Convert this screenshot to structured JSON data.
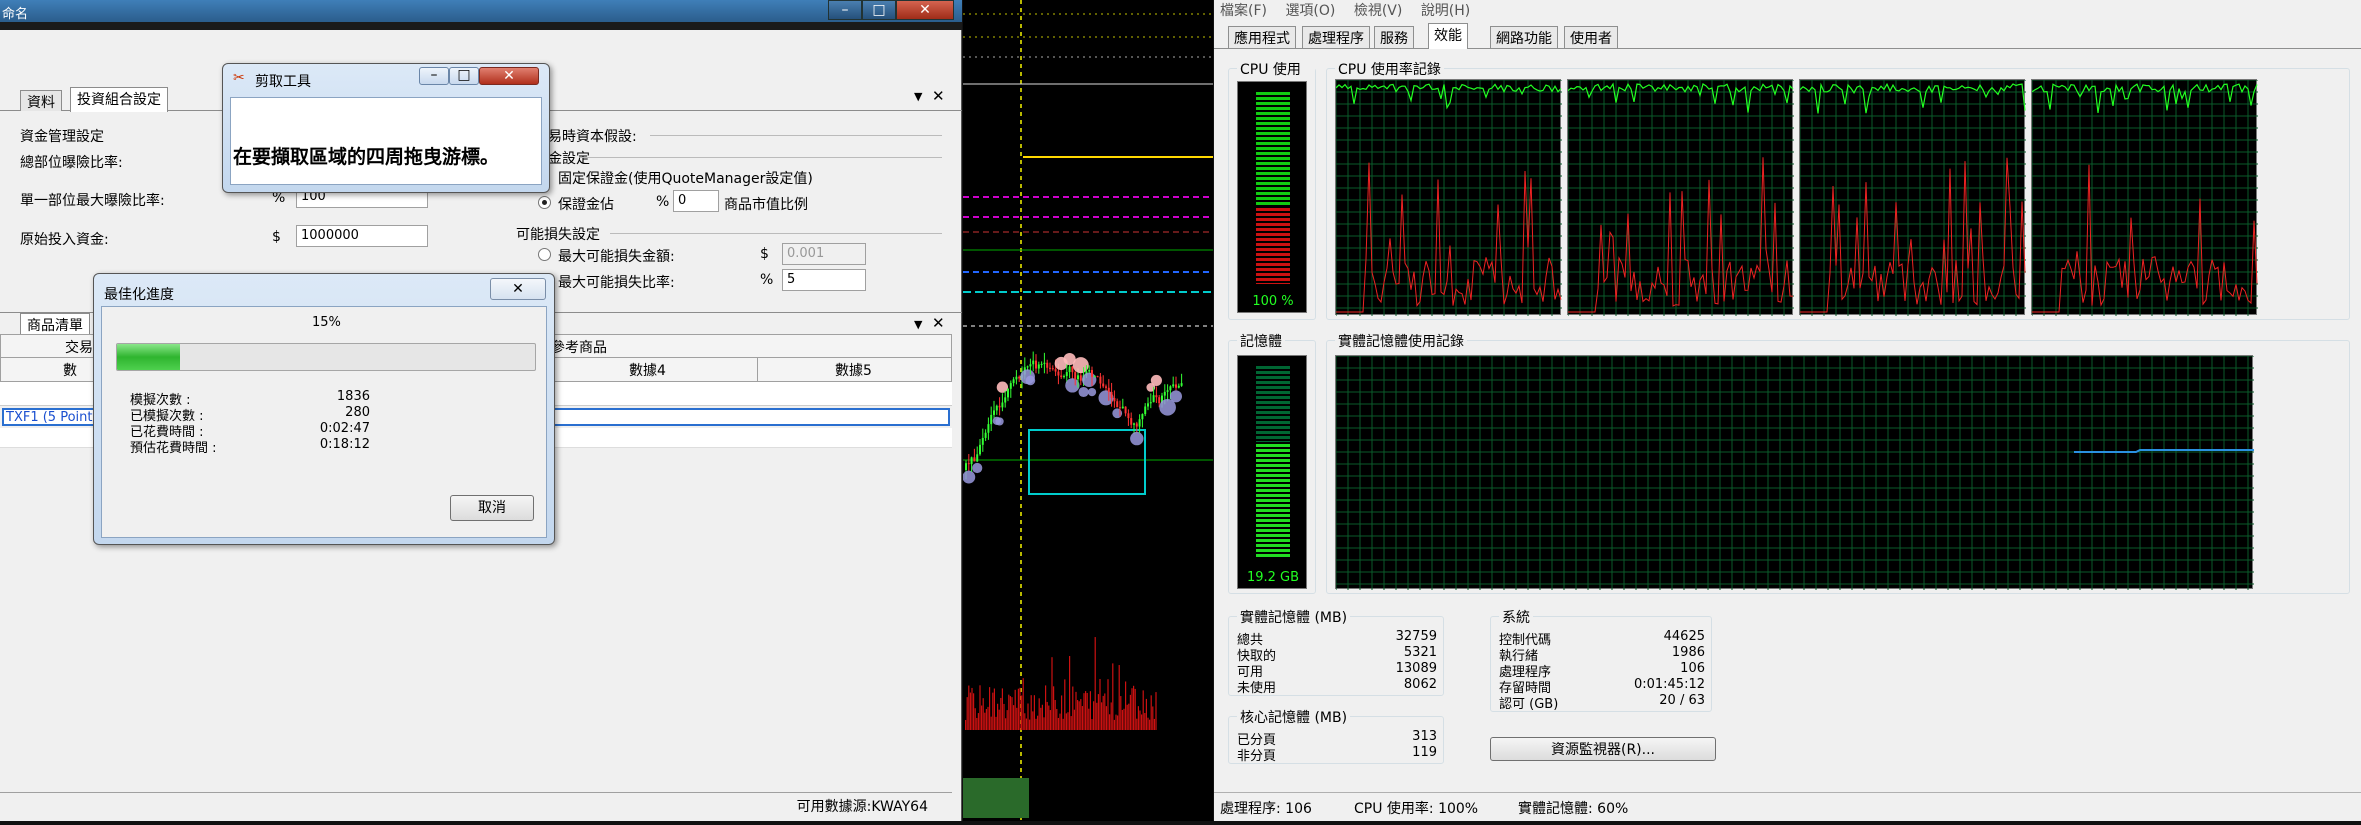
{
  "left_window": {
    "title": "命名",
    "tabs": [
      "資料",
      "投資組合設定"
    ],
    "settings": {
      "money_mgmt": "資金管理設定",
      "total_risk": "總部位曝險比率:",
      "single_risk": "單一部位最大曝險比率:",
      "single_risk_unit": "%",
      "single_risk_value": "100",
      "initial_capital": "原始投入資金:",
      "initial_capital_unit": "$",
      "initial_capital_value": "1000000",
      "trade_capital": "易時資本假設:",
      "margin_settings": "金設定",
      "fixed_margin": "固定保證金(使用QuoteManager設定值)",
      "margin_estimate": "保證金佔",
      "margin_unit": "%",
      "margin_value": "0",
      "margin_suffix": "商品市值比例",
      "loss_settings": "可能損失設定",
      "max_loss_amount": "最大可能損失金額:",
      "max_loss_amount_unit": "$",
      "max_loss_amount_value": "0.001",
      "max_loss_ratio": "最大可能損失比率:",
      "max_loss_ratio_unit": "%",
      "max_loss_ratio_value": "5"
    },
    "lower": {
      "tab": "商品清單",
      "col_trade": "交易",
      "col_ref": "參考商品",
      "col_data1": "數",
      "col_data4": "數據4",
      "col_data5": "數據5",
      "row1": "TXF1 (5 Points"
    },
    "status": "可用數據源:KWAY64"
  },
  "snip_dialog": {
    "title": "剪取工具",
    "message": "在要擷取區域的四周拖曳游標。"
  },
  "progress_dialog": {
    "title": "最佳化進度",
    "percent_text": "15%",
    "progress": 0.15,
    "rows": [
      {
        "label": "模擬次數 :",
        "value": "1836"
      },
      {
        "label": "已模擬次數 :",
        "value": "280"
      },
      {
        "label": "已花費時間 :",
        "value": "0:02:47"
      },
      {
        "label": "預估花費時間 :",
        "value": "0:18:12"
      }
    ],
    "cancel": "取消"
  },
  "task_manager": {
    "menu": [
      "檔案(F)",
      "選項(O)",
      "檢視(V)",
      "說明(H)"
    ],
    "tabs": [
      "應用程式",
      "處理程序",
      "服務",
      "效能",
      "網路功能",
      "使用者"
    ],
    "cpu_usage_title": "CPU 使用率",
    "cpu_history_title": "CPU 使用率記錄",
    "cpu_value": "100 %",
    "cpu_level": 1.0,
    "memory_title": "記憶體",
    "memory_history_title": "實體記憶體使用記錄",
    "memory_value": "19.2 GB",
    "memory_level": 0.6,
    "physical": {
      "title": "實體記憶體 (MB)",
      "rows": [
        {
          "k": "總共",
          "v": "32759"
        },
        {
          "k": "快取的",
          "v": "5321"
        },
        {
          "k": "可用",
          "v": "13089"
        },
        {
          "k": "未使用",
          "v": "8062"
        }
      ]
    },
    "kernel": {
      "title": "核心記憶體 (MB)",
      "rows": [
        {
          "k": "已分頁",
          "v": "313"
        },
        {
          "k": "非分頁",
          "v": "119"
        }
      ]
    },
    "system": {
      "title": "系統",
      "rows": [
        {
          "k": "控制代碼",
          "v": "44625"
        },
        {
          "k": "執行緒",
          "v": "1986"
        },
        {
          "k": "處理程序",
          "v": "106"
        },
        {
          "k": "存留時間",
          "v": "0:01:45:12"
        },
        {
          "k": "認可 (GB)",
          "v": "20 / 63"
        }
      ]
    },
    "resource_monitor": "資源監視器(R)...",
    "status": {
      "processes": "處理程序: 106",
      "cpu": "CPU 使用率: 100%",
      "memory": "實體記憶體: 60%"
    }
  }
}
